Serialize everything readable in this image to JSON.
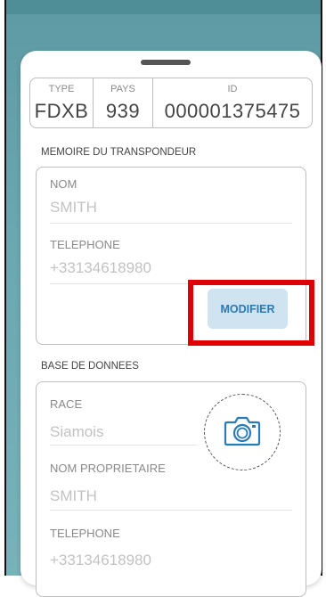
{
  "identifier": {
    "type_label": "TYPE",
    "type_value": "FDXB",
    "country_label": "PAYS",
    "country_value": "939",
    "id_label": "ID",
    "id_value": "000001375475"
  },
  "transponder_memory": {
    "title": "MEMOIRE DU TRANSPONDEUR",
    "name_label": "NOM",
    "name_value": "SMITH",
    "phone_label": "TELEPHONE",
    "phone_value": "+33134618980",
    "modify_label": "MODIFIER"
  },
  "database": {
    "title": "BASE DE DONNEES",
    "breed_label": "RACE",
    "breed_value": "Siamois",
    "owner_label": "NOM PROPRIETAIRE",
    "owner_value": "SMITH",
    "phone_label": "TELEPHONE",
    "phone_value": "+33134618980"
  },
  "icons": {
    "camera": "camera-icon",
    "handle": "drag-handle"
  },
  "colors": {
    "accent": "#2a7ab5",
    "button_bg": "#cfe3f1",
    "highlight": "#e00000",
    "background": "#6aa7b0"
  }
}
